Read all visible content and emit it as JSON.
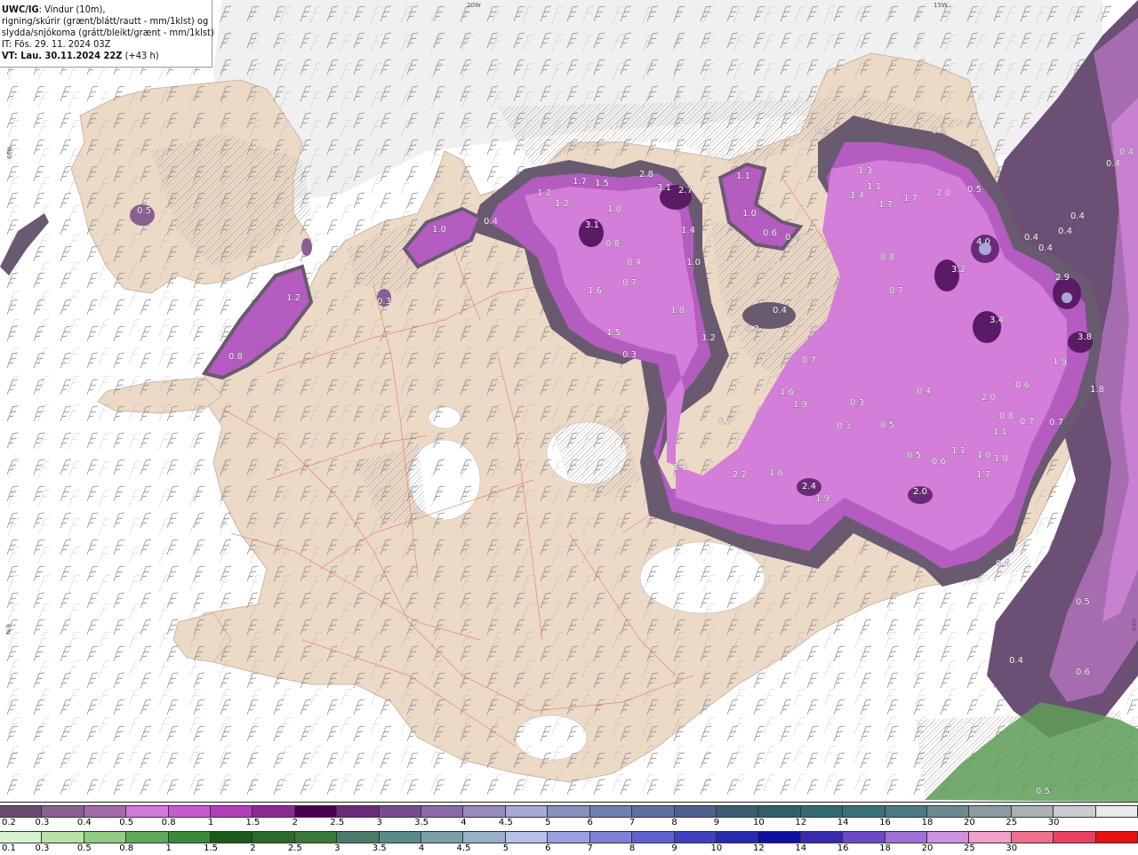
{
  "info": {
    "model": "UWC/IG",
    "line1_rest": ": Vindur (10m),",
    "line2": "rigning/skúrir (grænt/blátt/rautt - mm/1klst) og",
    "line3": "slydda/snjókoma (grátt/bleikt/grænt - mm/1klst)",
    "line4": "IT: Fös. 29. 11. 2024 03Z",
    "line5_bold": "VT: Lau. 30.11.2024 22Z",
    "line5_rest": " (+43 h)"
  },
  "grid_labels": {
    "lon_20w": "20W",
    "lon_15w": "15W",
    "lat_66n": "66N",
    "lat_64n": "64N",
    "lat_left_64": "N 9"
  },
  "map_values": [
    {
      "t": "0.5"
    },
    {
      "t": "1.2"
    },
    {
      "t": "0.8"
    },
    {
      "t": "0.3"
    },
    {
      "t": "1.0"
    },
    {
      "t": "0.4"
    },
    {
      "t": "1.2"
    },
    {
      "t": "1.7"
    },
    {
      "t": "1.5"
    },
    {
      "t": "2.8"
    },
    {
      "t": "3.1"
    },
    {
      "t": "2.7"
    },
    {
      "t": "1.2"
    },
    {
      "t": "1.0"
    },
    {
      "t": "3.1"
    },
    {
      "t": "0.8"
    },
    {
      "t": "0.4"
    },
    {
      "t": "1.4"
    },
    {
      "t": "1.0"
    },
    {
      "t": "1.6"
    },
    {
      "t": "0.7"
    },
    {
      "t": "1.8"
    },
    {
      "t": "1.5"
    },
    {
      "t": "1.2"
    },
    {
      "t": "0.3"
    },
    {
      "t": "1.1"
    },
    {
      "t": "1.0"
    },
    {
      "t": "0.6"
    },
    {
      "t": "0.4"
    },
    {
      "t": "0.3"
    },
    {
      "t": "0.4"
    },
    {
      "t": "1.3"
    },
    {
      "t": "1.1"
    },
    {
      "t": "1.4"
    },
    {
      "t": "1.7"
    },
    {
      "t": "1.7"
    },
    {
      "t": "2.0"
    },
    {
      "t": "0.5"
    },
    {
      "t": "0.8"
    },
    {
      "t": "0.7"
    },
    {
      "t": "4.0"
    },
    {
      "t": "3.2"
    },
    {
      "t": "3.4"
    },
    {
      "t": "2.9"
    },
    {
      "t": "3.8"
    },
    {
      "t": "1.9"
    },
    {
      "t": "1.8"
    },
    {
      "t": "0.4"
    },
    {
      "t": "0.4"
    },
    {
      "t": "0.4"
    },
    {
      "t": "0.4"
    },
    {
      "t": "0.4"
    },
    {
      "t": "0.4"
    },
    {
      "t": "0.7"
    },
    {
      "t": "1.6"
    },
    {
      "t": "1.9"
    },
    {
      "t": "0.7"
    },
    {
      "t": "0.3"
    },
    {
      "t": "0.3"
    },
    {
      "t": "0.5"
    },
    {
      "t": "0.4"
    },
    {
      "t": "2.0"
    },
    {
      "t": "0.6"
    },
    {
      "t": "0.8"
    },
    {
      "t": "1.1"
    },
    {
      "t": "0.7"
    },
    {
      "t": "0.7"
    },
    {
      "t": "1.1"
    },
    {
      "t": "1.0"
    },
    {
      "t": "1.0"
    },
    {
      "t": "0.5"
    },
    {
      "t": "0.6"
    },
    {
      "t": "1.7"
    },
    {
      "t": "1.0"
    },
    {
      "t": "2.2"
    },
    {
      "t": "1.6"
    },
    {
      "t": "2.4"
    },
    {
      "t": "1.9"
    },
    {
      "t": "2.0"
    },
    {
      "t": "0.3"
    },
    {
      "t": "0.4"
    },
    {
      "t": "0.5"
    },
    {
      "t": "0.4"
    },
    {
      "t": "0.6"
    },
    {
      "t": "0.5"
    },
    {
      "t": "0.5"
    }
  ],
  "legend": {
    "row1_colors": [
      "#6b4a72",
      "#8a5f93",
      "#a46aac",
      "#d07ad8",
      "#c45ccc",
      "#b040b8",
      "#8c2a94",
      "#4a0050",
      "#6a2a7a",
      "#7a4a90",
      "#8a6aa8",
      "#9a8ac0",
      "#a8a8d8",
      "#8890c0",
      "#7080b0",
      "#5f6f9f",
      "#4f5f8f",
      "#3a5f70",
      "#2f5f6a",
      "#2f6a70",
      "#3a7078",
      "#4a7a80",
      "#6a8a90",
      "#8a9aa0",
      "#aab0b4",
      "#c8ccce",
      "#e8eaea"
    ],
    "row1_labels": [
      "0.2",
      "0.3",
      "0.4",
      "0.5",
      "0.8",
      "1",
      "1.5",
      "2",
      "2.5",
      "3",
      "3.5",
      "4",
      "4.5",
      "5",
      "6",
      "7",
      "8",
      "9",
      "10",
      "12",
      "14",
      "16",
      "18",
      "20",
      "25",
      "30"
    ],
    "row2_colors": [
      "#d8f2d0",
      "#b8e2a8",
      "#90cc84",
      "#5faa5a",
      "#3a8a3a",
      "#1a5a1a",
      "#2a6a2a",
      "#3a7a3a",
      "#4a7a6a",
      "#5a8a8a",
      "#7aa0a8",
      "#9ab0c8",
      "#b8c0e8",
      "#9aa0e0",
      "#8080d8",
      "#6060d0",
      "#4040c0",
      "#2a2ab0",
      "#1010a0",
      "#3a2ab0",
      "#6a4ac8",
      "#a070d8",
      "#d090e0",
      "#f0a0c8",
      "#f07090",
      "#e84060",
      "#e81010"
    ],
    "row2_labels": [
      "0.1",
      "0.3",
      "0.5",
      "0.8",
      "1",
      "1.5",
      "2",
      "2.5",
      "3",
      "3.5",
      "4",
      "4.5",
      "5",
      "6",
      "7",
      "8",
      "9",
      "10",
      "12",
      "14",
      "16",
      "18",
      "20",
      "25",
      "30"
    ]
  },
  "colors": {
    "land": "#ecd9c6",
    "sea": "#ffffff",
    "precip_light": "#6a5a70",
    "precip_mid": "#b45cc0",
    "precip_heavy": "#d37ed9",
    "precip_core": "#5a1a66",
    "rain_green": "#5e9e56",
    "hatch": "#b8a8a0",
    "roads": "#e07050"
  }
}
